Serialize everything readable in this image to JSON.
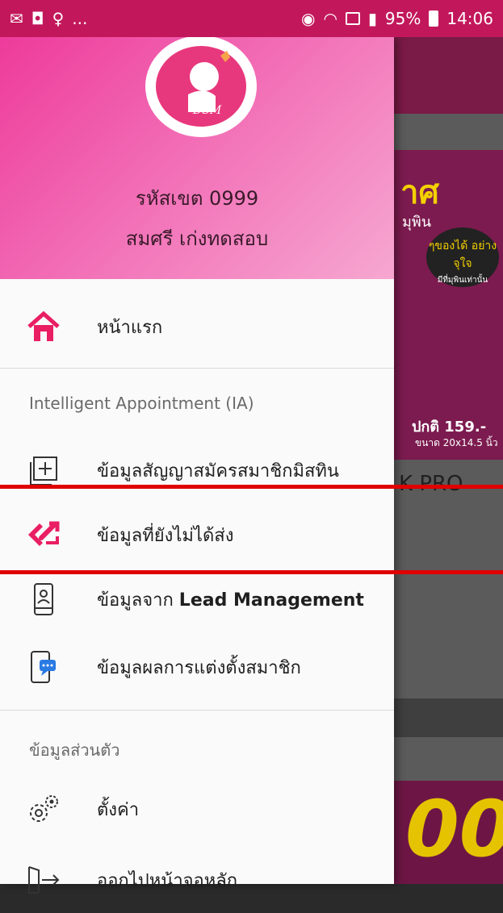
{
  "status_bar": {
    "battery": "95%",
    "time": "14:06",
    "dots": "...",
    "sim": "1"
  },
  "drawer": {
    "header": {
      "logo_text": "DSM",
      "code": "รหัสเขต 0999",
      "name": "สมศรี เก่งทดสอบ"
    },
    "home": "หน้าแรก",
    "section_ia": "Intelligent Appointment (IA)",
    "items": [
      {
        "label": "ข้อมูลสัญญาสมัครสมาชิกมิสทิน",
        "icon": "add-document-icon"
      },
      {
        "label": "ข้อมูลที่ยังไม่ได้ส่ง",
        "icon": "send-arrow-icon"
      },
      {
        "label_prefix": "ข้อมูลจาก ",
        "label_bold": "Lead Management",
        "icon": "phone-user-icon"
      },
      {
        "label": "ข้อมูลผลการแต่งตั้งสมาชิก",
        "icon": "phone-chat-icon"
      }
    ],
    "section_personal": "ข้อมูลส่วนตัว",
    "settings": "ตั้งค่า",
    "logout": "ออกไปหน้าจอหลัก"
  },
  "background": {
    "banner_title": "าศ",
    "banner_sub": "มุพิน",
    "bubble": "ๆของได้ อย่างจุใจ",
    "bubble_small": "มีที่มุพินเท่านั้น",
    "price": "ปกติ 159.-",
    "size": "ขนาด 20x14.5 นิ้ว",
    "pro": "K PRO",
    "banner2": "00"
  },
  "colors": {
    "accent_pink": "#ee3b9b",
    "icon_pink": "#e91e63",
    "highlight_red": "#e00000"
  }
}
